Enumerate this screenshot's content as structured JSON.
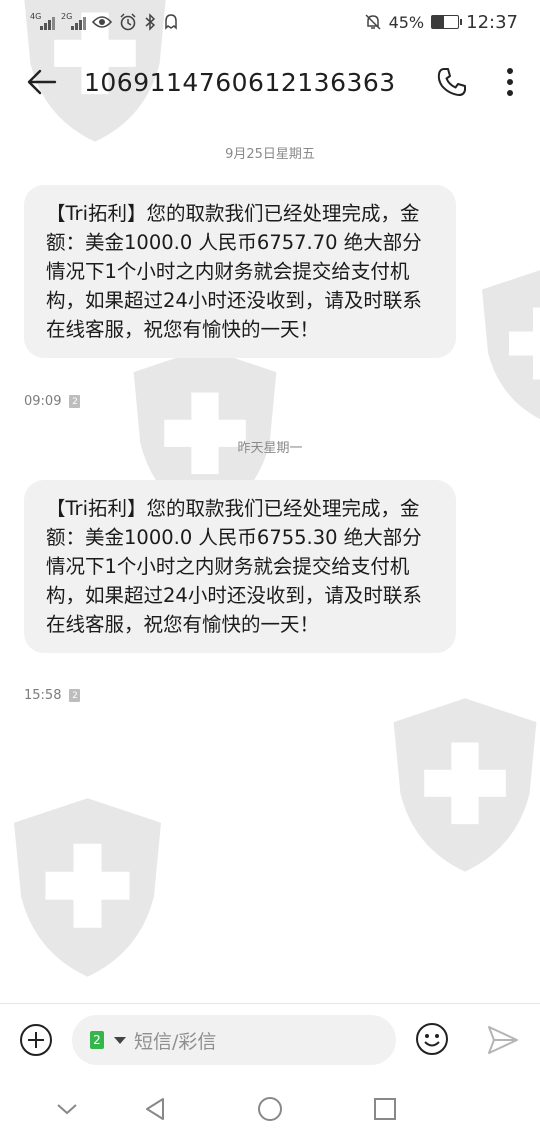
{
  "status_bar": {
    "left_icons": [
      "4g-signal-icon",
      "2g-signal-icon",
      "eye-icon",
      "alarm-icon",
      "bluetooth-icon",
      "notification-icon"
    ],
    "net_label_1": "4G",
    "net_label_2": "2G",
    "battery_percent": "45%",
    "battery_level": 0.45,
    "time": "12:37"
  },
  "header": {
    "title": "1069114760612136363"
  },
  "messages": [
    {
      "date": "9月25日星期五",
      "text": "【Tri拓利】您的取款我们已经处理完成，金额：美金1000.0 人民币6757.70 绝大部分情况下1个小时之内财务就会提交给支付机构，如果超过24小时还没收到，请及时联系在线客服，祝您有愉快的一天！",
      "time": "09:09",
      "sim": "2"
    },
    {
      "date": "昨天星期一",
      "text": "【Tri拓利】您的取款我们已经处理完成，金额：美金1000.0 人民币6755.30 绝大部分情况下1个小时之内财务就会提交给支付机构，如果超过24小时还没收到，请及时联系在线客服，祝您有愉快的一天！",
      "time": "15:58",
      "sim": "2"
    }
  ],
  "input": {
    "sim_label": "2",
    "placeholder": "短信/彩信"
  },
  "colors": {
    "bubble": "#f1f1f1",
    "sim_green": "#36b54a",
    "watermark": "#7a7a7a"
  }
}
